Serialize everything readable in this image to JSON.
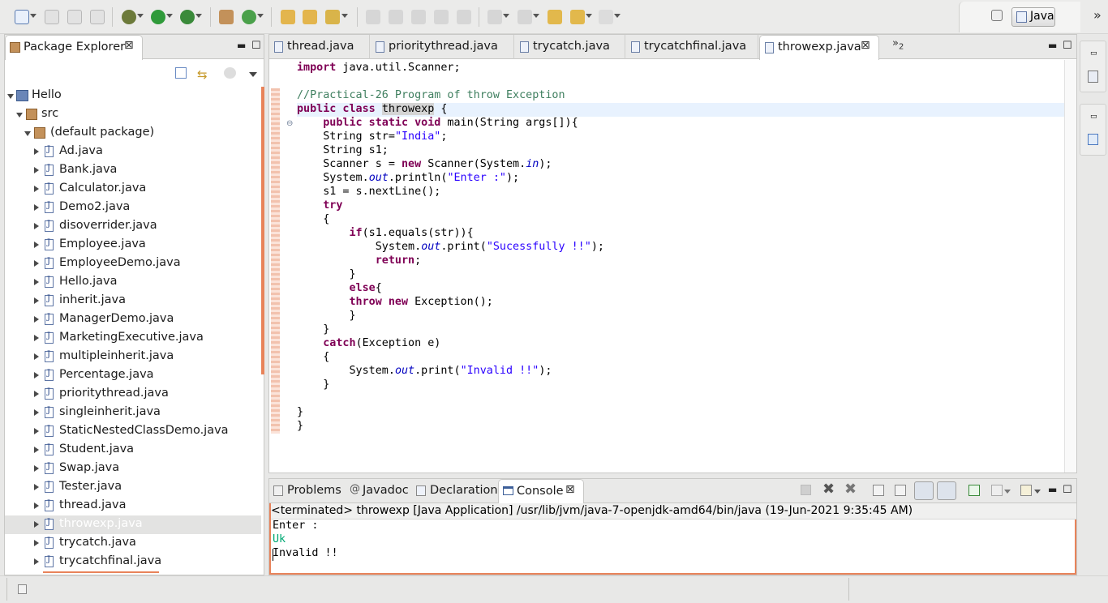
{
  "toolbar": {
    "perspective_label": "Java"
  },
  "package_explorer": {
    "title": "Package Explorer",
    "tree": {
      "project": "Hello",
      "src": "src",
      "package": "(default package)",
      "files": [
        "Ad.java",
        "Bank.java",
        "Calculator.java",
        "Demo2.java",
        "disoverrider.java",
        "Employee.java",
        "EmployeeDemo.java",
        "Hello.java",
        "inherit.java",
        "ManagerDemo.java",
        "MarketingExecutive.java",
        "multipleinherit.java",
        "Percentage.java",
        "prioritythread.java",
        "singleinherit.java",
        "StaticNestedClassDemo.java",
        "Student.java",
        "Swap.java",
        "Tester.java",
        "thread.java",
        "throwexp.java",
        "trycatch.java",
        "trycatchfinal.java"
      ],
      "selected_file": "throwexp.java"
    }
  },
  "editor": {
    "tabs": [
      "thread.java",
      "prioritythread.java",
      "trycatch.java",
      "trycatchfinal.java",
      "throwexp.java"
    ],
    "active_tab": "throwexp.java",
    "overflow_count": "2",
    "code": {
      "l1_kw": "import",
      "l1_rest": " java.util.Scanner;",
      "l3": "//Practical-26 Program of throw Exception",
      "l4_kw": "public class",
      "l4_name": "throwexp",
      "l4_rest": " {",
      "l5_kw": "public static void",
      "l5_rest": " main(String args[]){",
      "l6_a": "String str=",
      "l6_str": "\"India\"",
      "l6_b": ";",
      "l7": "String s1;",
      "l8_a": "Scanner s = ",
      "l8_kw": "new",
      "l8_b": " Scanner(System.",
      "l8_field": "in",
      "l8_c": ");",
      "l9_a": "System.",
      "l9_field": "out",
      "l9_b": ".println(",
      "l9_str": "\"Enter :\"",
      "l9_c": ");",
      "l10": "s1 = s.nextLine();",
      "l11_kw": "try",
      "l12": "{",
      "l13_kw": "if",
      "l13_rest": "(s1.equals(str)){",
      "l14_a": "System.",
      "l14_field": "out",
      "l14_b": ".print(",
      "l14_str": "\"Sucessfully !!\"",
      "l14_c": ");",
      "l15_kw": "return",
      "l15_rest": ";",
      "l16": "}",
      "l17_kw": "else",
      "l17_rest": "{",
      "l18_kw": "throw",
      "l18_kw2": "new",
      "l18_rest": " Exception();",
      "l19": "}",
      "l20": "}",
      "l21_kw": "catch",
      "l21_rest": "(Exception e)",
      "l22": "{",
      "l23_a": "System.",
      "l23_field": "out",
      "l23_b": ".print(",
      "l23_str": "\"Invalid !!\"",
      "l23_c": ");",
      "l24": "}",
      "l26": "}",
      "l27": "}"
    }
  },
  "bottom": {
    "tabs": [
      "Problems",
      "Javadoc",
      "Declaration",
      "Console"
    ],
    "active_tab": "Console",
    "console_header": "<terminated> throwexp [Java Application] /usr/lib/jvm/java-7-openjdk-amd64/bin/java (19-Jun-2021 9:35:45 AM)",
    "console_lines": [
      "Enter :",
      "Uk",
      "Invalid !!"
    ],
    "input_color": "#00a873"
  },
  "colors": {
    "keyword": "#7f0055",
    "comment": "#3f7f5f",
    "string": "#2a00ff",
    "accent": "#e8835a"
  }
}
